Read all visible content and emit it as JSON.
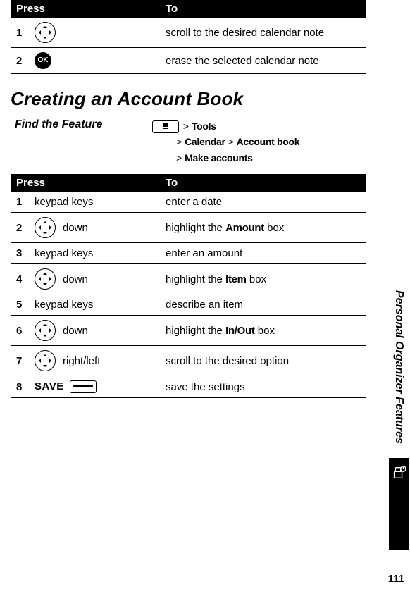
{
  "table1": {
    "header": {
      "press": "Press",
      "to": "To"
    },
    "rows": [
      {
        "num": "1",
        "to": "scroll to the desired calendar note"
      },
      {
        "num": "2",
        "to": "erase the selected calendar note"
      }
    ]
  },
  "section_heading": "Creating an Account Book",
  "feature": {
    "label": "Find the Feature",
    "gt": ">",
    "path": {
      "tools": "Tools",
      "calendar": "Calendar",
      "account_book": "Account book",
      "make_accounts": "Make accounts"
    }
  },
  "table2": {
    "header": {
      "press": "Press",
      "to": "To"
    },
    "rows": [
      {
        "num": "1",
        "press": "keypad keys",
        "to_pre": "enter a date"
      },
      {
        "num": "2",
        "press": "down",
        "to_pre": "highlight the ",
        "to_bold": "Amount",
        "to_post": " box"
      },
      {
        "num": "3",
        "press": "keypad keys",
        "to_pre": "enter an amount"
      },
      {
        "num": "4",
        "press": "down",
        "to_pre": "highlight the ",
        "to_bold": "Item",
        "to_post": " box"
      },
      {
        "num": "5",
        "press": "keypad keys",
        "to_pre": "describe an item"
      },
      {
        "num": "6",
        "press": "down",
        "to_pre": "highlight the ",
        "to_bold": "In/Out",
        "to_post": " box"
      },
      {
        "num": "7",
        "press": "right/left",
        "to_pre": "scroll to the desired option"
      },
      {
        "num": "8",
        "press": "SAVE",
        "to_pre": "save the settings"
      }
    ]
  },
  "sidebar_text": "Personal Organizer Features",
  "page_number": "111",
  "ok_label": "OK"
}
